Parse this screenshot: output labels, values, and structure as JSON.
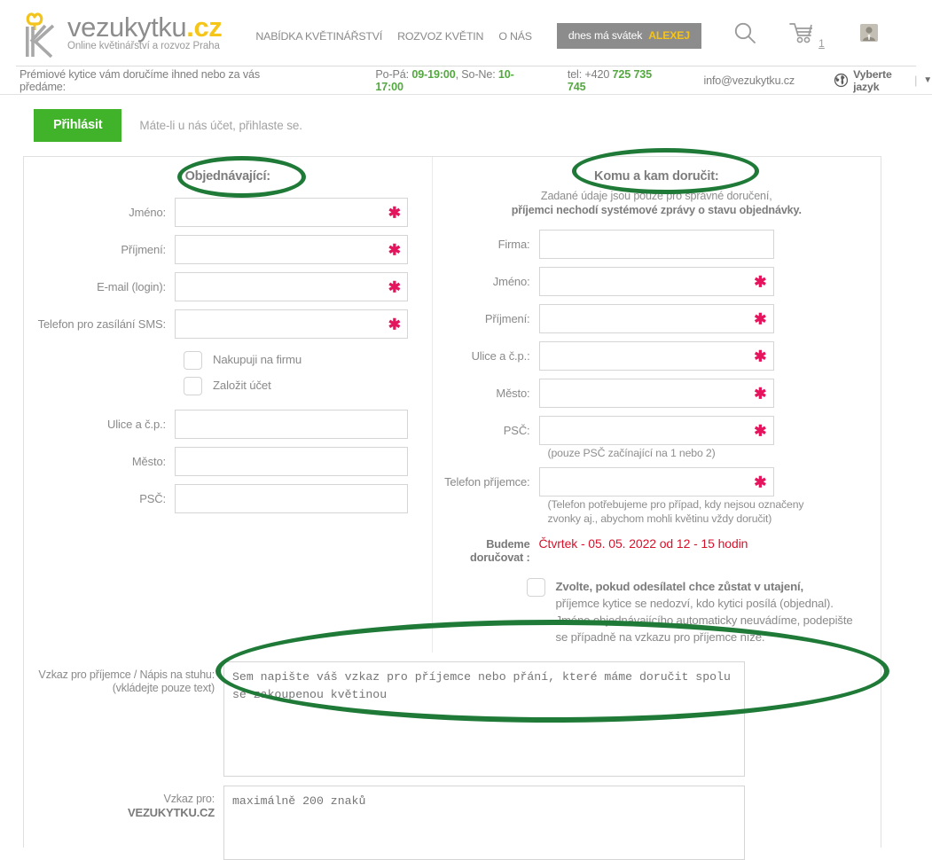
{
  "header": {
    "logo": {
      "word": "vezukytku",
      "tld": ".cz",
      "tagline": "Online květinářství a rozvoz Praha"
    },
    "nav": [
      {
        "label": "NABÍDKA KVĚTINÁŘSTVÍ"
      },
      {
        "label": "ROZVOZ KVĚTIN"
      },
      {
        "label": "O NÁS"
      }
    ],
    "nameday": {
      "text": "dnes má svátek",
      "name": "ALEXEJ"
    },
    "icons": {
      "search": "search-icon",
      "cart": "cart-icon",
      "account": "user-icon"
    },
    "cart_count": "1"
  },
  "infobar": {
    "slogan": "Prémiové kytice vám doručíme ihned nebo za vás předáme:",
    "hours_weekday_label": "Po-Pá:",
    "hours_weekday": "09-19:00",
    "hours_weekend_label": "So-Ne:",
    "hours_weekend": "10-17:00",
    "tel_label": "tel: +420",
    "tel": "725 735 745",
    "email": "info@vezukytku.cz",
    "lang": "Vyberte jazyk",
    "lang_caret": "▼"
  },
  "login": {
    "button": "Přihlásit",
    "note": "Máte-li u nás účet, přihlaste se."
  },
  "orderer": {
    "title": "Objednávající:",
    "fields": [
      {
        "label": "Jméno:",
        "value": "",
        "required": true
      },
      {
        "label": "Příjmení:",
        "value": "",
        "required": true
      },
      {
        "label": "E-mail (login):",
        "value": "",
        "required": true
      },
      {
        "label": "Telefon pro zasílání SMS:",
        "value": "",
        "required": true
      }
    ],
    "checkboxes": [
      {
        "label": "Nakupuji na firmu",
        "checked": false
      },
      {
        "label": "Založit účet",
        "checked": false
      }
    ],
    "address_fields": [
      {
        "label": "Ulice a č.p.:",
        "value": "",
        "required": false
      },
      {
        "label": "Město:",
        "value": "",
        "required": false
      },
      {
        "label": "PSČ:",
        "value": "",
        "required": false
      }
    ]
  },
  "recipient": {
    "title": "Komu a kam doručit:",
    "note_line1": "Zadané údaje jsou pouze pro správné doručení,",
    "note_line2": "příjemci nechodí systémové zprávy o stavu objednávky.",
    "fields": [
      {
        "label": "Firma:",
        "value": "",
        "required": false
      },
      {
        "label": "Jméno:",
        "value": "",
        "required": true
      },
      {
        "label": "Příjmení:",
        "value": "",
        "required": true
      },
      {
        "label": "Ulice a č.p.:",
        "value": "",
        "required": true
      },
      {
        "label": "Město:",
        "value": "",
        "required": true
      },
      {
        "label": "PSČ:",
        "value": "",
        "required": true
      }
    ],
    "psc_hint": "(pouze PSČ začínající na 1 nebo 2)",
    "phone_field": {
      "label": "Telefon příjemce:",
      "value": "",
      "required": true
    },
    "phone_hint_line1": "(Telefon potřebujeme pro případ, kdy nejsou označeny",
    "phone_hint_line2": "zvonky aj., abychom mohli květinu vždy doručit)",
    "delivery_label": "Budeme doručovat :",
    "delivery_value": "Čtvrtek - 05. 05. 2022 od 12 - 15 hodin",
    "anonymous": {
      "checked": false,
      "line1": "Zvolte, pokud odesílatel chce zůstat v utajení,",
      "line2": "příjemce kytice se nedozví, kdo kytici posílá (objednal).",
      "line3": "Jméno objednávajícího automaticky neuvádíme, podepište",
      "line4": "se případně na vzkazu pro příjemce níže."
    }
  },
  "messages": {
    "recipient_message": {
      "label_line1": "Vzkaz pro příjemce / Nápis na stuhu:",
      "label_line2": "(vkládejte pouze text)",
      "placeholder": "Sem napište váš vzkaz pro příjemce nebo přání, které máme doručit spolu se zakoupenou květinou",
      "value": ""
    },
    "shop_message": {
      "label_line1": "Vzkaz pro:",
      "label_brand": "VEZUKYTKU.CZ",
      "placeholder": "maximálně 200 znaků",
      "value": ""
    }
  },
  "colors": {
    "brand_green": "#41b32a",
    "accent_yellow": "#f3c41d",
    "required_pink": "#e4145d",
    "delivery_red": "#d8122b",
    "annotation_green": "#1f7a38"
  }
}
